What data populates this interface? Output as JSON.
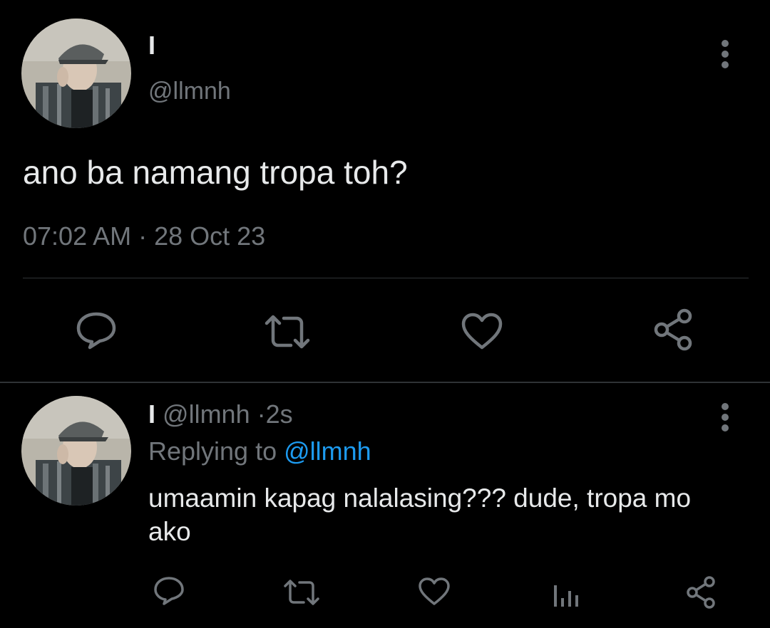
{
  "colors": {
    "background": "#000000",
    "text": "#e7e9ea",
    "muted": "#71767b",
    "link": "#1d9bf0",
    "divider": "#2f3336"
  },
  "main_tweet": {
    "display_name": "I",
    "handle": "@llmnh",
    "text": "ano ba namang tropa toh?",
    "timestamp": "07:02 AM · 28 Oct 23",
    "actions": [
      "comment-icon",
      "retweet-icon",
      "heart-icon",
      "share-icon"
    ],
    "more_icon": "more-vertical-icon"
  },
  "reply": {
    "display_name": "I",
    "handle": "@llmnh",
    "separator": "·",
    "time_ago": "2s",
    "replying_to_label": "Replying to",
    "replying_to_handle": "@llmnh",
    "text": "umaamin kapag nalalasing??? dude, tropa mo ako",
    "actions": [
      "comment-icon",
      "retweet-icon",
      "heart-icon",
      "analytics-icon",
      "share-icon"
    ],
    "more_icon": "more-vertical-icon"
  }
}
